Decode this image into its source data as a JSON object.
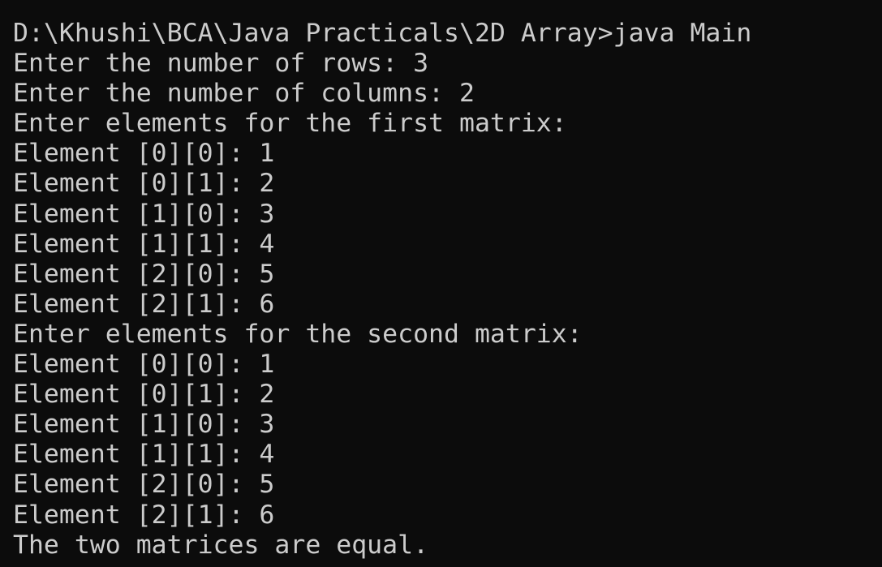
{
  "terminal": {
    "background": "#0c0c0c",
    "foreground": "#cccccc",
    "lines": [
      "D:\\Khushi\\BCA\\Java Practicals\\2D Array>java Main",
      "Enter the number of rows: 3",
      "Enter the number of columns: 2",
      "Enter elements for the first matrix:",
      "Element [0][0]: 1",
      "Element [0][1]: 2",
      "Element [1][0]: 3",
      "Element [1][1]: 4",
      "Element [2][0]: 5",
      "Element [2][1]: 6",
      "Enter elements for the second matrix:",
      "Element [0][0]: 1",
      "Element [0][1]: 2",
      "Element [1][0]: 3",
      "Element [1][1]: 4",
      "Element [2][0]: 5",
      "Element [2][1]: 6",
      "The two matrices are equal."
    ]
  }
}
